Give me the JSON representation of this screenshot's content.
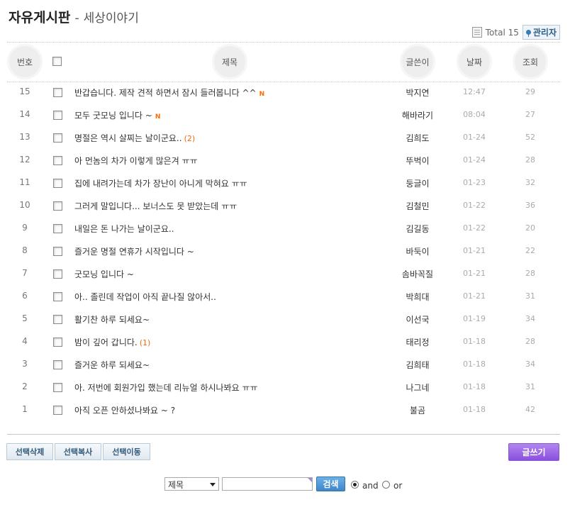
{
  "board": {
    "title": "자유게시판",
    "separator": "-",
    "subtitle": "세상이야기"
  },
  "top": {
    "total_label": "Total 15",
    "admin_label": "관리자"
  },
  "columns": {
    "num": "번호",
    "title": "제목",
    "author": "글쓴이",
    "date": "날짜",
    "views": "조회"
  },
  "posts": [
    {
      "num": "15",
      "title": "반갑습니다. 제작 견적 하면서 잠시 들러봅니다 ^^",
      "new": "N",
      "comments": "",
      "author": "박지연",
      "date": "12:47",
      "views": "29"
    },
    {
      "num": "14",
      "title": "모두 굿모닝 입니다 ~",
      "new": "N",
      "comments": "",
      "author": "해바라기",
      "date": "08:04",
      "views": "27"
    },
    {
      "num": "13",
      "title": "명절은 역시 살찌는 날이군요..",
      "new": "",
      "comments": "(2)",
      "author": "김희도",
      "date": "01-24",
      "views": "52"
    },
    {
      "num": "12",
      "title": "아 먼놈의 차가 이렇게 많은겨 ㅠㅠ",
      "new": "",
      "comments": "",
      "author": "뚜벅이",
      "date": "01-24",
      "views": "28"
    },
    {
      "num": "11",
      "title": "집에 내려가는데 차가 장난이 아니게 막혀요 ㅠㅠ",
      "new": "",
      "comments": "",
      "author": "둥글이",
      "date": "01-23",
      "views": "32"
    },
    {
      "num": "10",
      "title": "그러게 말입니다... 보너스도 못 받았는데 ㅠㅠ",
      "new": "",
      "comments": "",
      "author": "김철민",
      "date": "01-22",
      "views": "36"
    },
    {
      "num": "9",
      "title": "내일은 돈 나가는 날이군요..",
      "new": "",
      "comments": "",
      "author": "김길동",
      "date": "01-22",
      "views": "20"
    },
    {
      "num": "8",
      "title": "즐거운 명절 연휴가 시작입니다 ~",
      "new": "",
      "comments": "",
      "author": "바둑이",
      "date": "01-21",
      "views": "22"
    },
    {
      "num": "7",
      "title": "굿모닝 입니다 ~",
      "new": "",
      "comments": "",
      "author": "솜바꼭질",
      "date": "01-21",
      "views": "28"
    },
    {
      "num": "6",
      "title": "아.. 졸린데 작업이 아직 끝나질 않아서..",
      "new": "",
      "comments": "",
      "author": "박희대",
      "date": "01-21",
      "views": "31"
    },
    {
      "num": "5",
      "title": "활기찬 하루 되세요~",
      "new": "",
      "comments": "",
      "author": "이선국",
      "date": "01-19",
      "views": "34"
    },
    {
      "num": "4",
      "title": "밤이 깊어 갑니다.",
      "new": "",
      "comments": "(1)",
      "author": "태리정",
      "date": "01-18",
      "views": "28"
    },
    {
      "num": "3",
      "title": "즐거운 하루 되세요~",
      "new": "",
      "comments": "",
      "author": "김희태",
      "date": "01-18",
      "views": "34"
    },
    {
      "num": "2",
      "title": "아. 저번에 회원가입 했는데 리뉴얼 하시나봐요 ㅠㅠ",
      "new": "",
      "comments": "",
      "author": "나그네",
      "date": "01-18",
      "views": "31"
    },
    {
      "num": "1",
      "title": "아직 오픈 안하셨나봐요 ~ ?",
      "new": "",
      "comments": "",
      "author": "불곰",
      "date": "01-18",
      "views": "42"
    }
  ],
  "actions": {
    "delete": "선택삭제",
    "copy": "선택복사",
    "move": "선택이동",
    "write": "글쓰기"
  },
  "search": {
    "field_selected": "제목",
    "input_value": "",
    "button": "검색",
    "opt_and": "and",
    "opt_or": "or"
  }
}
